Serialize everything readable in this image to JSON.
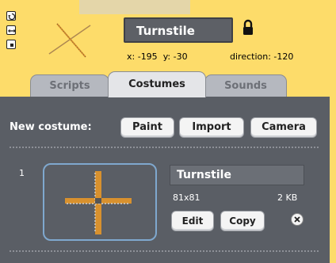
{
  "sprite": {
    "name": "Turnstile",
    "x_label": "x:",
    "x_value": "-195",
    "y_label": "y:",
    "y_value": "-30",
    "direction_label": "direction:",
    "direction_value": "-120"
  },
  "rotation_style_icons": [
    "rotate-icon",
    "flip-left-right-icon",
    "no-rotate-icon"
  ],
  "tabs": [
    {
      "label": "Scripts",
      "active": false
    },
    {
      "label": "Costumes",
      "active": true
    },
    {
      "label": "Sounds",
      "active": false
    }
  ],
  "new_costume": {
    "label": "New costume:",
    "buttons": [
      "Paint",
      "Import",
      "Camera"
    ]
  },
  "costumes": [
    {
      "number": "1",
      "name": "Turnstile",
      "dimensions": "81x81",
      "size": "2 KB",
      "edit_label": "Edit",
      "copy_label": "Copy"
    }
  ],
  "colors": {
    "background": "#fddc6a",
    "panel": "#5a5e65",
    "selection_border": "#7fa8ce",
    "turnstile_arm": "#d8912e"
  }
}
